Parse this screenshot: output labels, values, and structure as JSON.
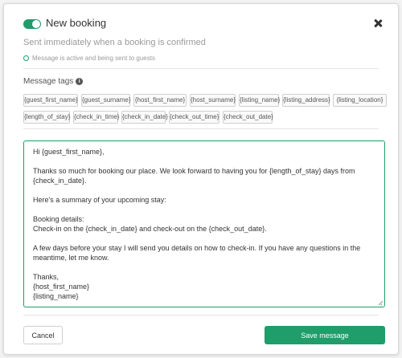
{
  "header": {
    "title": "New booking",
    "toggle_on": true,
    "accent_color": "#1f9d6b"
  },
  "subtitle": "Sent immediately when a booking is confirmed",
  "status": "Message is active and being sent to guests",
  "tags_label": "Message tags",
  "tags": [
    "{guest_first_name}",
    "{guest_surname}",
    "{host_first_name}",
    "{host_surname}",
    "{listing_name}",
    "{listing_address}",
    "{listing_location}",
    "{length_of_stay}",
    "{check_in_time}",
    "{check_in_date}",
    "{check_out_time}",
    "{check_out_date}"
  ],
  "message": {
    "line1": "Hi {guest_first_name},",
    "line2": "Thanks so much for booking our place. We look forward to having you for {length_of_stay} days from {check_in_date}.",
    "line3": "Here's a summary of your upcoming stay:",
    "line4": "Booking details:",
    "line5": "Check-in on the {check_in_date} and check-out on the {check_out_date}.",
    "line6": "A few days before your stay I will send you details on how to check-in. If you have any questions in the meantime, let me know.",
    "line7": "Thanks,",
    "line8": "{host_first_name}",
    "line9": "{listing_name}"
  },
  "footer": {
    "cancel_label": "Cancel",
    "save_label": "Save message"
  }
}
